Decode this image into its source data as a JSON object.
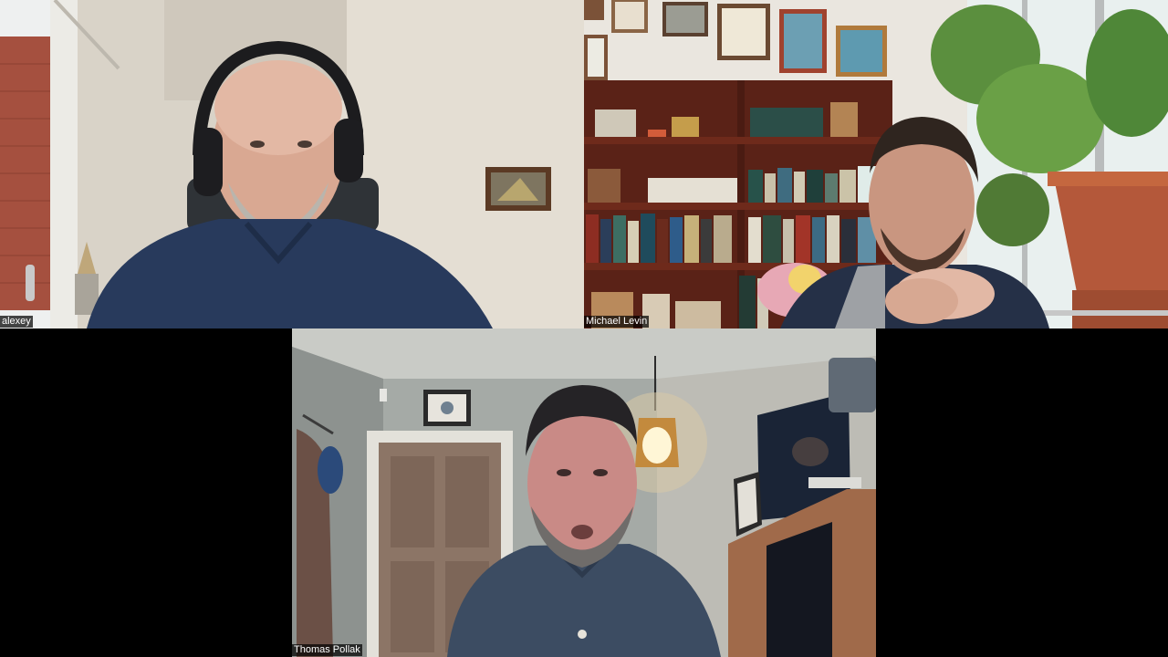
{
  "app": {
    "view": "gallery"
  },
  "participants": [
    {
      "name": "alexey"
    },
    {
      "name": "Michael Levin"
    },
    {
      "name": "Thomas Pollak"
    }
  ],
  "colors": {
    "background": "#000000",
    "name_tag_bg": "#000000",
    "name_tag_text": "#ffffff"
  }
}
